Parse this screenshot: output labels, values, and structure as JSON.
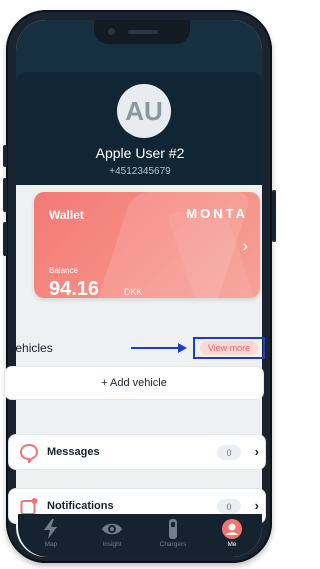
{
  "profile": {
    "initials": "AU",
    "name": "Apple User #2",
    "phone": "+4512345679"
  },
  "wallet": {
    "title": "Wallet",
    "brand": "MONTA",
    "balance_label": "Balance",
    "balance_value": "94.16",
    "currency": "DKK"
  },
  "vehicles": {
    "label": "Vehicles",
    "view_more_label": "View more",
    "add_vehicle_label": "+ Add vehicle"
  },
  "rows": [
    {
      "label": "Messages",
      "count": "0",
      "icon": "message-icon"
    },
    {
      "label": "Notifications",
      "count": "0",
      "icon": "notification-icon"
    }
  ],
  "tabbar": {
    "tabs": [
      {
        "label": "Map",
        "icon": "lightning-icon",
        "active": false
      },
      {
        "label": "Insight",
        "icon": "eye-icon",
        "active": false
      },
      {
        "label": "Chargers",
        "icon": "charger-icon",
        "active": false
      },
      {
        "label": "Me",
        "icon": "user-icon",
        "active": true
      }
    ]
  },
  "colors": {
    "accent": "#f3736f",
    "header_bg": "#112634",
    "annotation_blue": "#1b3cc8"
  }
}
